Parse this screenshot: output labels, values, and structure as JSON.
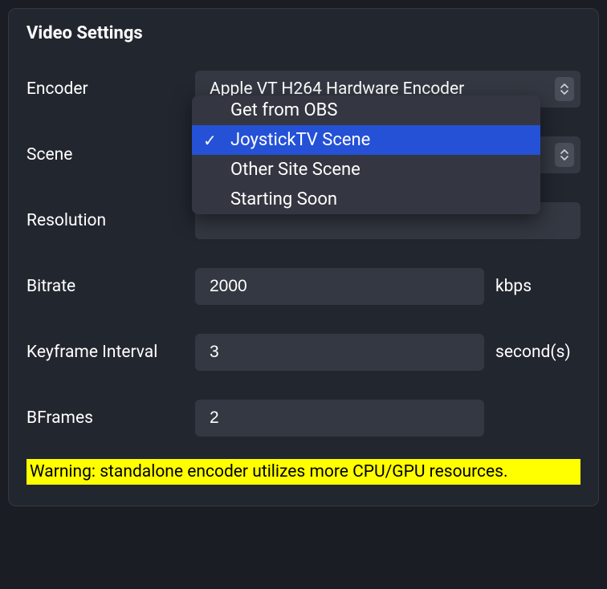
{
  "panel": {
    "title": "Video Settings"
  },
  "fields": {
    "encoder": {
      "label": "Encoder",
      "value": "Apple VT H264 Hardware Encoder"
    },
    "scene": {
      "label": "Scene",
      "value": "JoystickTV Scene",
      "options": [
        {
          "label": "Get from OBS",
          "selected": false
        },
        {
          "label": "JoystickTV Scene",
          "selected": true
        },
        {
          "label": "Other Site Scene",
          "selected": false
        },
        {
          "label": "Starting Soon",
          "selected": false
        }
      ]
    },
    "resolution": {
      "label": "Resolution"
    },
    "bitrate": {
      "label": "Bitrate",
      "value": "2000",
      "unit": "kbps"
    },
    "keyframe": {
      "label": "Keyframe Interval",
      "value": "3",
      "unit": "second(s)"
    },
    "bframes": {
      "label": "BFrames",
      "value": "2"
    }
  },
  "warning": "Warning: standalone encoder utilizes more CPU/GPU resources.",
  "icons": {
    "checkmark": "✓"
  }
}
